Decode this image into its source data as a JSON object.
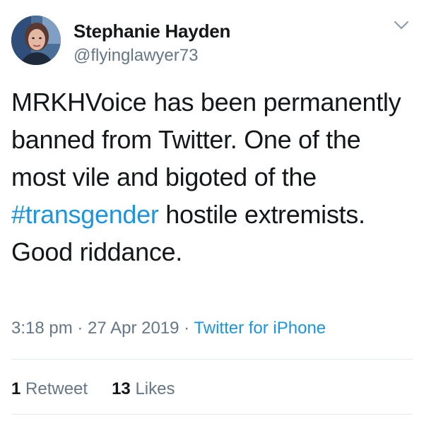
{
  "author": {
    "display_name": "Stephanie Hayden",
    "handle": "@flyinglawyer73"
  },
  "tweet": {
    "text_before": "MRKHVoice has been permanently banned from Twitter. One of the most vile and bigoted of the ",
    "hashtag": "#transgender",
    "text_after": " hostile extremists. Good riddance."
  },
  "meta": {
    "time": "3:18 pm",
    "separator": " · ",
    "date": "27 Apr 2019",
    "source": "Twitter for iPhone"
  },
  "stats": {
    "retweets_count": "1",
    "retweets_label": "Retweet",
    "likes_count": "13",
    "likes_label": "Likes"
  },
  "colors": {
    "link": "#1b95e0",
    "secondary_text": "#657786",
    "primary_text": "#14171a",
    "divider": "#e1e8ed"
  },
  "icons": {
    "menu": "chevron-down-icon",
    "avatar": "avatar"
  }
}
